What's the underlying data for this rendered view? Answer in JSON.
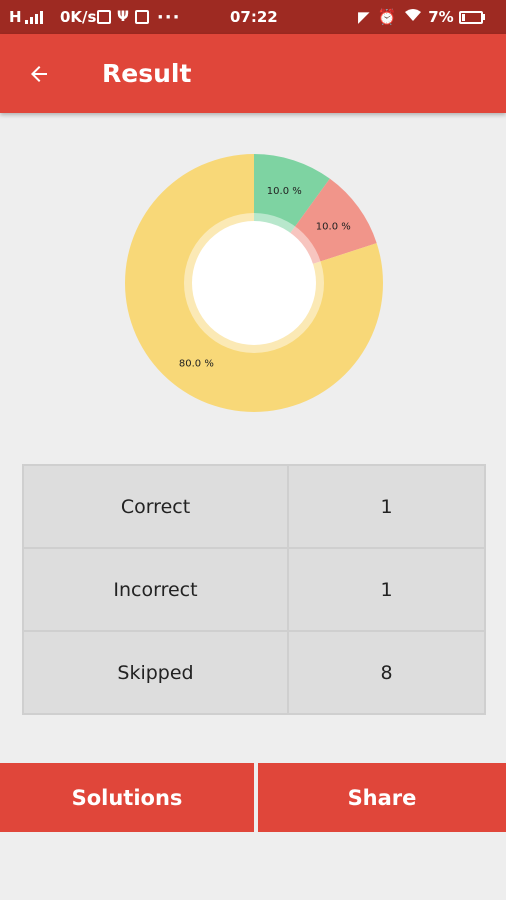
{
  "status_bar": {
    "network_label": "H",
    "speed": "0K/s",
    "time": "07:22",
    "battery_pct": "7%"
  },
  "app_bar": {
    "title": "Result",
    "back_icon": "arrow-left-icon"
  },
  "colors": {
    "app_bar": "#e0463a",
    "status_bar": "#9e2a22",
    "correct": "#7ed3a2",
    "incorrect": "#f1958a",
    "skipped": "#f8d878"
  },
  "chart_data": {
    "type": "pie",
    "donut": true,
    "categories": [
      "Correct",
      "Incorrect",
      "Skipped"
    ],
    "values": [
      10.0,
      10.0,
      80.0
    ],
    "labels": [
      "10.0 %",
      "10.0 %",
      "80.0 %"
    ],
    "colors": [
      "#7ed3a2",
      "#f1958a",
      "#f8d878"
    ]
  },
  "results": {
    "rows": [
      {
        "label": "Correct",
        "value": "1"
      },
      {
        "label": "Incorrect",
        "value": "1"
      },
      {
        "label": "Skipped",
        "value": "8"
      }
    ]
  },
  "buttons": {
    "solutions": "Solutions",
    "share": "Share"
  }
}
